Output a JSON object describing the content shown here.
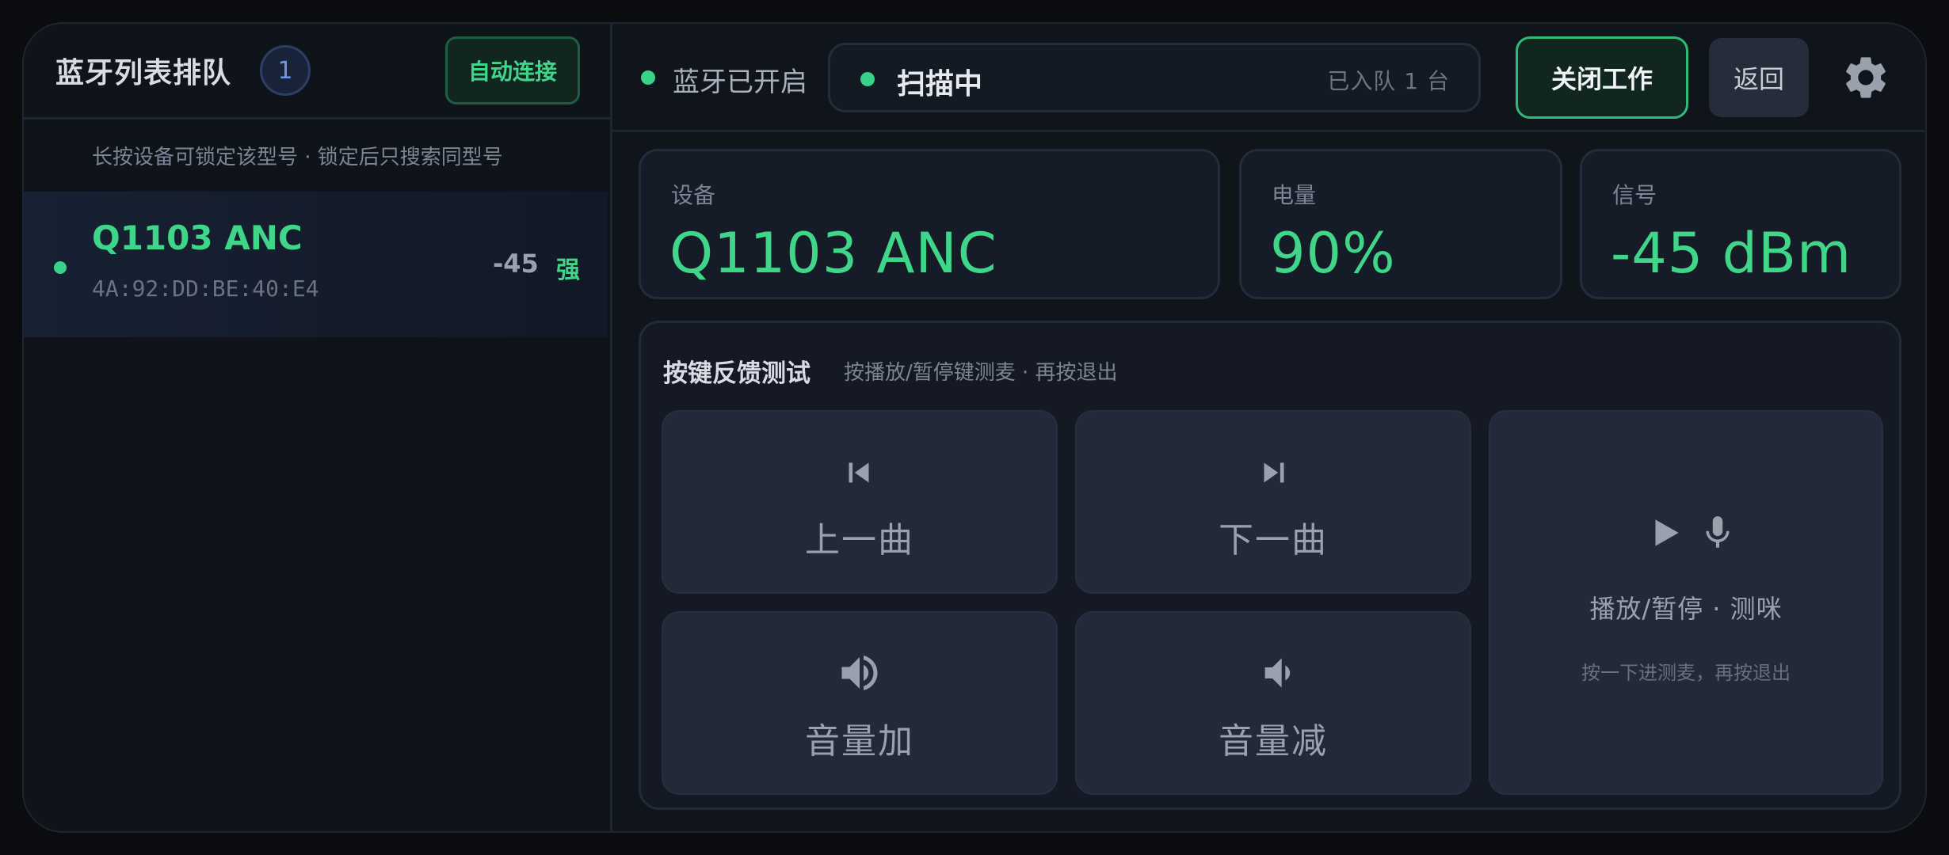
{
  "left_panel": {
    "title": "蓝牙列表排队",
    "count": "1",
    "auto_connect_label": "自动连接",
    "hint": "长按设备可锁定该型号 · 锁定后只搜索同型号",
    "devices": [
      {
        "name": "Q1103 ANC",
        "mac": "4A:92:DD:BE:40:E4",
        "rssi": "-45",
        "strength": "强"
      }
    ]
  },
  "topbar": {
    "bluetooth_status": "蓝牙已开启",
    "scan_status": "扫描中",
    "queue_text": "已入队 1 台",
    "stop_label": "关闭工作",
    "back_label": "返回",
    "settings_icon": "gear-icon"
  },
  "stats": {
    "device": {
      "label": "设备",
      "value": "Q1103 ANC"
    },
    "battery": {
      "label": "电量",
      "value": "90%"
    },
    "signal": {
      "label": "信号",
      "value": "-45 dBm"
    }
  },
  "key_test": {
    "title": "按键反馈测试",
    "subtitle": "按播放/暂停键测麦 · 再按退出",
    "keys": {
      "prev": {
        "label": "上一曲",
        "icon": "skip-previous-icon"
      },
      "next": {
        "label": "下一曲",
        "icon": "skip-next-icon"
      },
      "vol_up": {
        "label": "音量加",
        "icon": "volume-up-icon"
      },
      "vol_down": {
        "label": "音量减",
        "icon": "volume-down-icon"
      },
      "play": {
        "label": "播放/暂停 · 测咪",
        "hint": "按一下进测麦，再按退出",
        "icons": [
          "play-icon",
          "microphone-icon"
        ]
      }
    }
  },
  "colors": {
    "accent_green": "#3fd68a",
    "badge_blue": "#6f95e6",
    "background": "#10141b"
  }
}
